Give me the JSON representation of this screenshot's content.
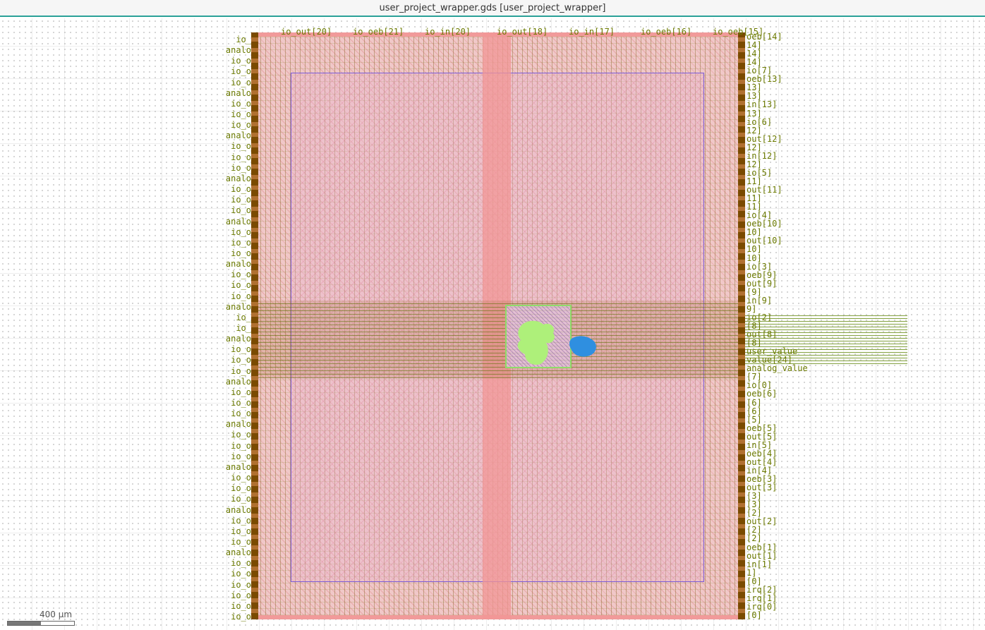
{
  "window": {
    "title": "user_project_wrapper.gds [user_project_wrapper]"
  },
  "colors": {
    "die_border": "#f19a9a",
    "core_border": "#7a5bd6",
    "pin_label": "#6b7a00",
    "macro_green": "#aef07a",
    "macro_blue": "#2f8fe0"
  },
  "scale": {
    "label": "400 µm"
  },
  "pins": {
    "top": [
      "io_out[20]",
      "io_oeb[21]",
      "io_in[20]",
      "io_out[18]",
      "io_in[17]",
      "io_oeb[16]",
      "io_oeb[15]"
    ],
    "left": [
      "io_",
      "analo",
      "io_o",
      "io_o",
      "io_o",
      "analo",
      "io_o",
      "io_o",
      "io_o",
      "analo",
      "io_o",
      "io_o",
      "io_o",
      "analo",
      "io_o",
      "io_o",
      "io_o",
      "analo",
      "io_o",
      "io_o",
      "io_o",
      "analo",
      "io_o",
      "io_o",
      "io_o",
      "analo",
      "io_",
      "io_",
      "analo",
      "io_o",
      "io_o",
      "io_o",
      "analo",
      "io_o",
      "io_o",
      "io_o",
      "analo",
      "io_o",
      "io_o",
      "io_o",
      "analo",
      "io_o",
      "io_o",
      "io_o",
      "analo",
      "io_o",
      "io_o",
      "io_o",
      "analo",
      "io_o",
      "io_o",
      "io_o",
      "io_o",
      "io_o",
      "io_o"
    ],
    "right": [
      "oeb[14]",
      "14]",
      "14]",
      "14]",
      "io[7]",
      "oeb[13]",
      "13]",
      "13]",
      "in[13]",
      "13]",
      "io[6]",
      "12]",
      "out[12]",
      "12]",
      "in[12]",
      "12]",
      "io[5]",
      "11]",
      "out[11]",
      "11]",
      "11]",
      "io[4]",
      "oeb[10]",
      "10]",
      "out[10]",
      "10]",
      "10]",
      "io[3]",
      "oeb[9]",
      "out[9]",
      "[9]",
      "in[9]",
      "9]",
      "io[2]",
      "[8]",
      "out[8]",
      "[8]",
      "user_value",
      "value[24]",
      "analog_value",
      "[7]",
      "io[0]",
      "oeb[6]",
      "[6]",
      "[6]",
      "[5]",
      "oeb[5]",
      "out[5]",
      "in[5]",
      "oeb[4]",
      "out[4]",
      "in[4]",
      "oeb[3]",
      "out[3]",
      "[3]",
      "[3]",
      "[2]",
      "out[2]",
      "[2]",
      "[2]",
      "oeb[1]",
      "out[1]",
      "in[1]",
      "1]",
      "[0]",
      "irq[2]",
      "irq[1]",
      "irq[0]",
      "[0]"
    ]
  }
}
